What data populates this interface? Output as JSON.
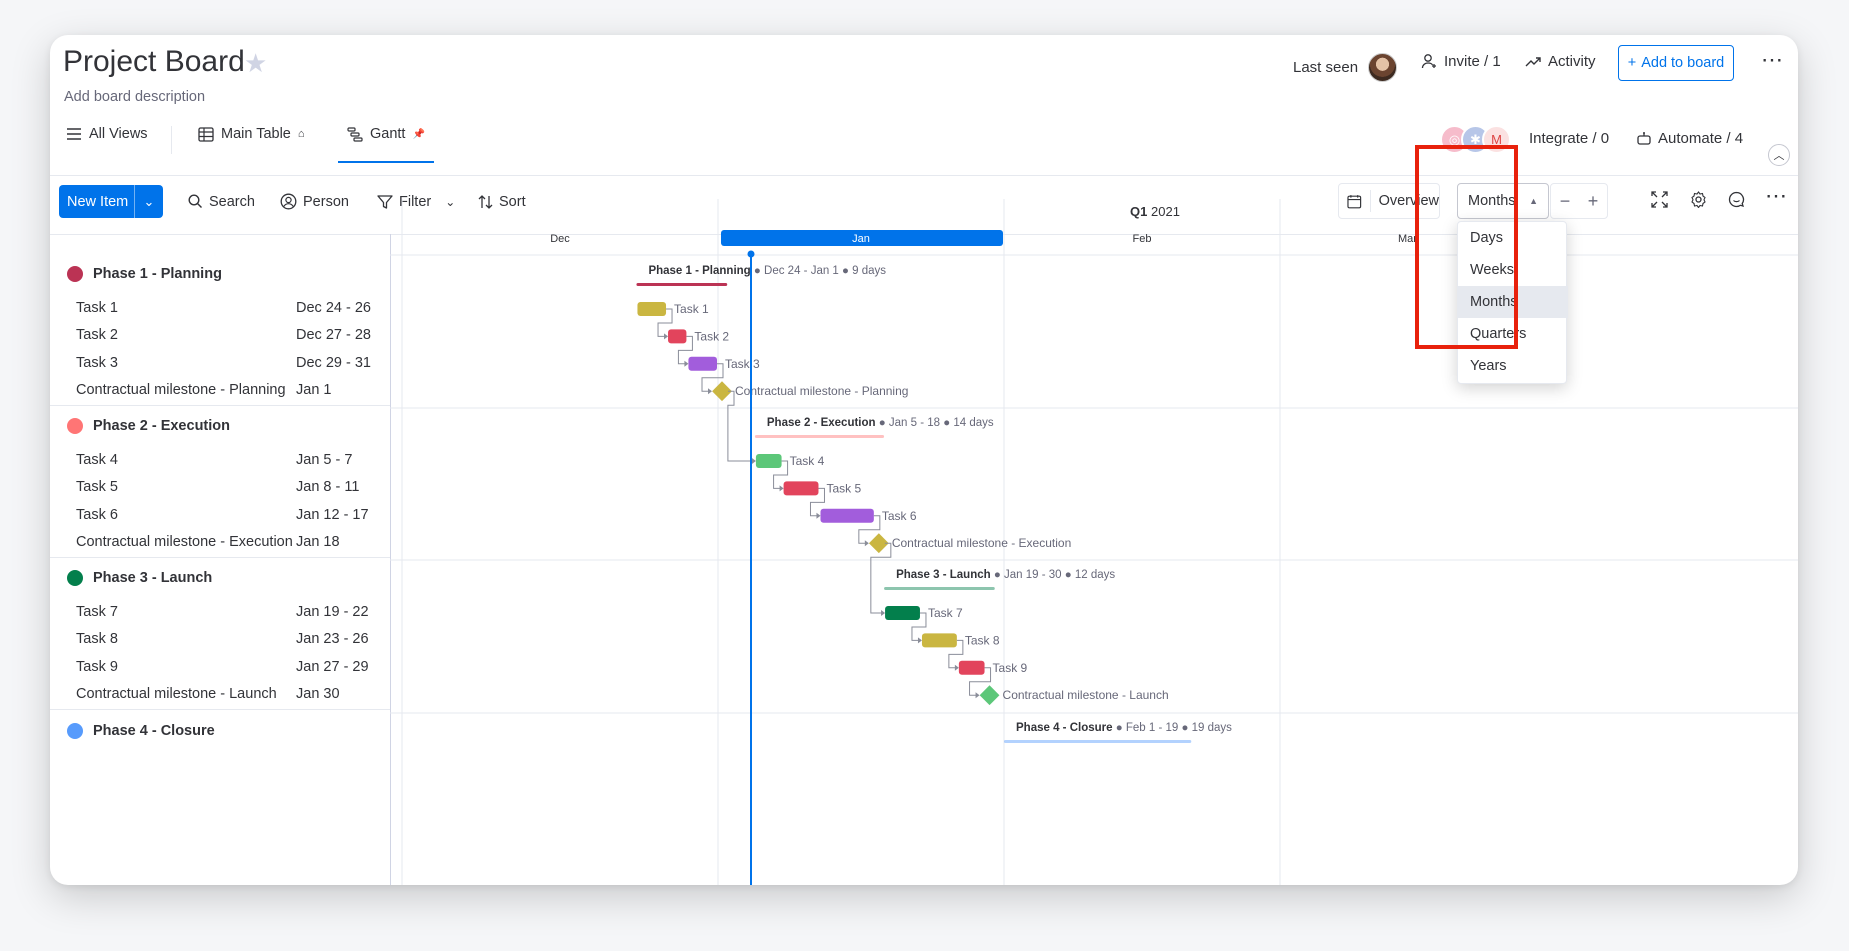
{
  "board": {
    "title": "Project Board",
    "description": "Add board description",
    "last_seen_label": "Last seen",
    "invite_label": "Invite / 1",
    "activity_label": "Activity",
    "add_to_board_label": "Add to board"
  },
  "views": {
    "all_views": "All Views",
    "main_table": "Main Table",
    "gantt": "Gantt",
    "integrate": "Integrate / 0",
    "automate": "Automate / 4"
  },
  "toolbar": {
    "new_item": "New Item",
    "search": "Search",
    "person": "Person",
    "filter": "Filter",
    "sort": "Sort",
    "overview": "Overview",
    "scale_selected": "Months"
  },
  "scale_dropdown": {
    "options": [
      "Days",
      "Weeks",
      "Months",
      "Quarters",
      "Years"
    ],
    "selected": "Months"
  },
  "timeline": {
    "quarter_bold": "Q1",
    "quarter_year": "2021",
    "months": [
      "Dec",
      "Jan",
      "Feb",
      "Mar"
    ],
    "current_month": "Jan"
  },
  "groups": [
    {
      "name": "Phase 1 - Planning",
      "color": "#bb3354",
      "summary_dates": "Dec 24 - Jan 1",
      "summary_duration": "9 days",
      "items": [
        {
          "name": "Task 1",
          "dates": "Dec 24 - 26",
          "color": "#cab641"
        },
        {
          "name": "Task 2",
          "dates": "Dec 27 - 28",
          "color": "#e2445c"
        },
        {
          "name": "Task 3",
          "dates": "Dec 29 - 31",
          "color": "#a25ddc"
        },
        {
          "name": "Contractual milestone - Planning",
          "dates": "Jan 1",
          "color": "#cab641",
          "milestone": true
        }
      ]
    },
    {
      "name": "Phase 2 - Execution",
      "color": "#ff7575",
      "summary_dates": "Jan 5 - 18",
      "summary_duration": "14 days",
      "items": [
        {
          "name": "Task 4",
          "dates": "Jan 5 - 7",
          "color": "#5cc779"
        },
        {
          "name": "Task 5",
          "dates": "Jan 8 - 11",
          "color": "#e2445c"
        },
        {
          "name": "Task 6",
          "dates": "Jan 12 - 17",
          "color": "#a25ddc"
        },
        {
          "name": "Contractual milestone - Execution",
          "dates": "Jan 18",
          "color": "#cab641",
          "milestone": true
        }
      ]
    },
    {
      "name": "Phase 3 - Launch",
      "color": "#037f4c",
      "summary_dates": "Jan 19 - 30",
      "summary_duration": "12 days",
      "items": [
        {
          "name": "Task 7",
          "dates": "Jan 19 - 22",
          "color": "#037f4c"
        },
        {
          "name": "Task 8",
          "dates": "Jan 23 - 26",
          "color": "#cab641"
        },
        {
          "name": "Task 9",
          "dates": "Jan 27 - 29",
          "color": "#e2445c"
        },
        {
          "name": "Contractual milestone - Launch",
          "dates": "Jan 30",
          "color": "#5cc779",
          "milestone": true
        }
      ]
    },
    {
      "name": "Phase 4 - Closure",
      "color": "#579bfc",
      "summary_dates": "Feb 1 - 19",
      "summary_duration": "19 days",
      "items": []
    }
  ],
  "colors": {
    "accent": "#0073ea",
    "highlight": "#e8210c",
    "today_line": "#0073ea"
  }
}
